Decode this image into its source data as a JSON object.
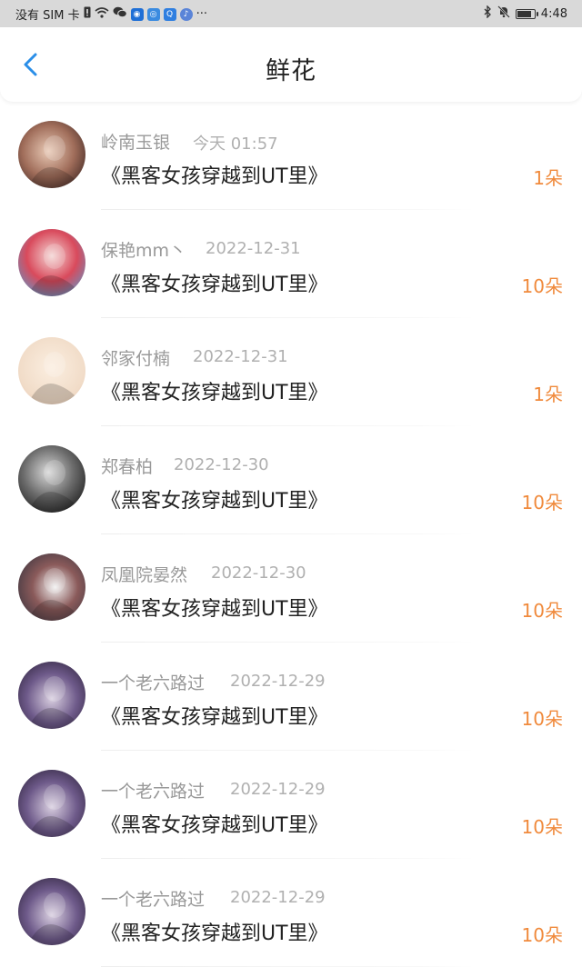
{
  "status_bar": {
    "carrier": "没有 SIM 卡",
    "more": "···",
    "time": "4:48",
    "battery_level": 0.9
  },
  "header": {
    "title": "鲜花"
  },
  "items": [
    {
      "user": "岭南玉银",
      "date": "今天 01:57",
      "book": "《黑客女孩穿越到UT里》",
      "count": "1朵"
    },
    {
      "user": "保艳mm丶",
      "date": "2022-12-31",
      "book": "《黑客女孩穿越到UT里》",
      "count": "10朵"
    },
    {
      "user": "邻家付楠",
      "date": "2022-12-31",
      "book": "《黑客女孩穿越到UT里》",
      "count": "1朵"
    },
    {
      "user": "郑春柏",
      "date": "2022-12-30",
      "book": "《黑客女孩穿越到UT里》",
      "count": "10朵"
    },
    {
      "user": "凤凰院晏然",
      "date": "2022-12-30",
      "book": "《黑客女孩穿越到UT里》",
      "count": "10朵"
    },
    {
      "user": "一个老六路过",
      "date": "2022-12-29",
      "book": "《黑客女孩穿越到UT里》",
      "count": "10朵"
    },
    {
      "user": "一个老六路过",
      "date": "2022-12-29",
      "book": "《黑客女孩穿越到UT里》",
      "count": "10朵"
    },
    {
      "user": "一个老六路过",
      "date": "2022-12-29",
      "book": "《黑客女孩穿越到UT里》",
      "count": "10朵"
    }
  ],
  "colors": {
    "accent": "#2a8ee8",
    "count": "#f08a3c"
  }
}
